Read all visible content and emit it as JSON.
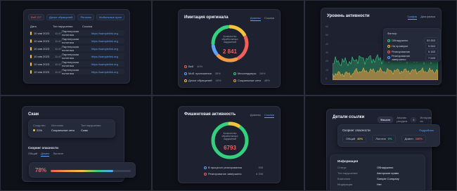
{
  "colors": {
    "accent": "#5da2ff",
    "green": "#33d07e",
    "red": "#f0605a",
    "yellow": "#f5c43a",
    "orange": "#f59b42",
    "purple": "#9a73ff"
  },
  "table_panel": {
    "filters": [
      "Веб 227",
      "Досье обращений",
      "Регионы",
      "Мобильные прил"
    ],
    "headers": [
      "Дата",
      "Тип нарушения",
      "Ссылка"
    ],
    "rows": [
      {
        "date": "10 янв 2023",
        "time": "11:47",
        "type": "Партнерская политика",
        "link": "https://samplelink.org"
      },
      {
        "date": "10 янв 2023",
        "time": "11:47",
        "type": "Партнерская политика",
        "link": "https://samplelink.org"
      },
      {
        "date": "10 янв 2023",
        "time": "11:47",
        "type": "Партнерская политика",
        "link": "https://samplelink.org"
      },
      {
        "date": "10 янв 2023",
        "time": "11:47",
        "type": "Партнерская политика",
        "link": "https://samplelink.org"
      },
      {
        "date": "10 янв 2023",
        "time": "11:47",
        "type": "Партнерская политика",
        "link": "https://samplelink.org"
      },
      {
        "date": "10 янв 2023",
        "time": "11:47",
        "type": "Партнерская политика",
        "link": "https://samplelink.org"
      }
    ]
  },
  "imitation_panel": {
    "title": "Имитация оригинала",
    "tabs": [
      "Домены",
      "Ссылки"
    ],
    "center_label": "Количество обработанных нарушений",
    "center_value": "2 841",
    "legend": [
      {
        "label": "Веб",
        "value": "40%",
        "color": "#f0605a"
      },
      {
        "label": "Моб. приложения",
        "value": "35%",
        "color": "#5da2ff"
      },
      {
        "label": "Досье обращений",
        "value": "40%",
        "color": "#f5c43a"
      },
      {
        "label": "Мессенджеры",
        "value": "56%",
        "color": "#33d07e"
      },
      {
        "label": "Социальные сети",
        "value": "48%",
        "color": "#f59b42"
      }
    ]
  },
  "activity_panel": {
    "title": "Уровень активности",
    "tabs": [
      "График",
      "Диаграмма"
    ],
    "popup_title": "Фильтр",
    "popup_items": [
      {
        "label": "Обнаружено",
        "value": "53 653",
        "color": "#33d07e"
      },
      {
        "label": "На проверке",
        "value": "5 844",
        "color": "#f5c43a"
      },
      {
        "label": "Реагирование",
        "value": "5 183",
        "color": "#f0605a"
      },
      {
        "label": "Реагирование завершено",
        "value": "7 645",
        "color": "#5da2ff"
      }
    ],
    "y_ticks": [
      "60",
      "50",
      "40",
      "30",
      "20",
      "10",
      "0"
    ]
  },
  "scam_panel": {
    "title": "Скам",
    "col_headers": [
      "Сходство",
      "Источник",
      "Тип нарушения"
    ],
    "col_values": [
      "21%",
      "Социальные сети",
      "Скам"
    ],
    "risk_title": "Скоринг опасности",
    "risk_tabs": [
      "Общий",
      "Домен",
      "Логотип"
    ],
    "risk_value": "78%",
    "risk_fraction": 0.78
  },
  "phishing_panel": {
    "title": "Фишинговая активность",
    "tabs": [
      "Домены",
      "Ссылки"
    ],
    "center_label": "Количество обработанных нарушений",
    "center_value": "6793",
    "legend": [
      {
        "label": "В процессе реагирования",
        "value": "395",
        "color": "#5da2ff"
      },
      {
        "label": "Реагирование завершено",
        "value": "6 398",
        "color": "#f0605a"
      }
    ]
  },
  "link_panel": {
    "title": "Детали ссылки",
    "tabs": [
      "Фишинг",
      "Анализ ресурса",
      "История из"
    ],
    "tab_badge": "5",
    "score_title": "Скоринг опасности",
    "score_link": "Подробнее",
    "scores": [
      {
        "label": "Общий",
        "value": "40%",
        "color": "#f5c43a"
      },
      {
        "label": "Логотип",
        "value": "0%",
        "color": "#33d07e"
      },
      {
        "label": "Домен",
        "value": "100%",
        "color": "#f0605a"
      }
    ],
    "info_title": "Информация",
    "info": [
      {
        "k": "Статус",
        "v": "Обнаружено"
      },
      {
        "k": "Тип нарушения",
        "v": "Авторское право"
      },
      {
        "k": "Компания",
        "v": "Sample Company"
      },
      {
        "k": "Модерация",
        "v": "Нет"
      }
    ]
  }
}
